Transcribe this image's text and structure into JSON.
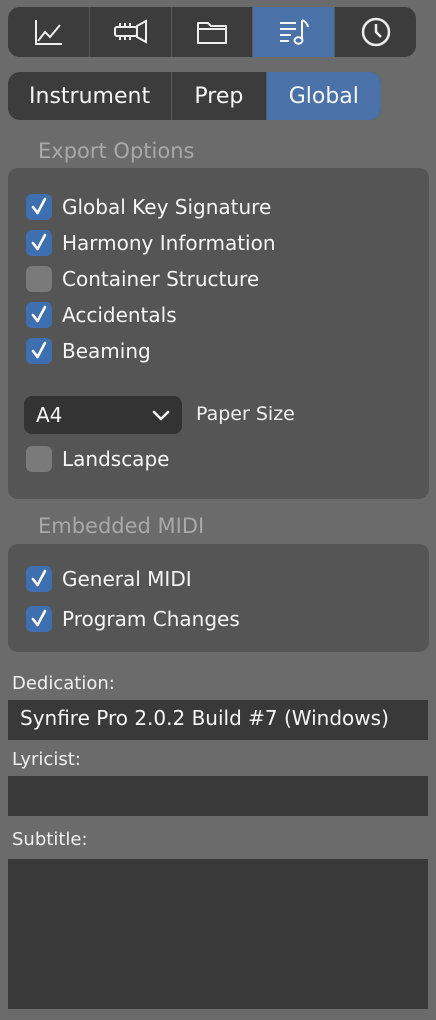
{
  "toolbar": {
    "buttons": [
      {
        "icon": "line-chart-icon",
        "active": false
      },
      {
        "icon": "trumpet-icon",
        "active": false
      },
      {
        "icon": "folder-icon",
        "active": false
      },
      {
        "icon": "score-notes-icon",
        "active": true
      },
      {
        "icon": "clock-icon",
        "active": false
      }
    ]
  },
  "tabs": [
    {
      "label": "Instrument"
    },
    {
      "label": "Prep"
    },
    {
      "label": "Global",
      "active": true
    }
  ],
  "export_options": {
    "title": "Export Options",
    "checks": [
      {
        "label": "Global Key Signature",
        "checked": true
      },
      {
        "label": "Harmony Information",
        "checked": true
      },
      {
        "label": "Container Structure",
        "checked": false
      },
      {
        "label": "Accidentals",
        "checked": true
      },
      {
        "label": "Beaming",
        "checked": true
      }
    ],
    "paper_size_value": "A4",
    "paper_size_label": "Paper Size",
    "landscape": {
      "label": "Landscape",
      "checked": false
    }
  },
  "embedded_midi": {
    "title": "Embedded MIDI",
    "checks": [
      {
        "label": "General MIDI",
        "checked": true
      },
      {
        "label": "Program Changes",
        "checked": true
      }
    ]
  },
  "fields": {
    "dedication": {
      "label": "Dedication:",
      "value": "Synfire Pro 2.0.2 Build #7 (Windows)"
    },
    "lyricist": {
      "label": "Lyricist:",
      "value": ""
    },
    "subtitle": {
      "label": "Subtitle:",
      "value": ""
    }
  },
  "colors": {
    "accent": "#4a72a8",
    "checkbox_on": "#3e6fb0",
    "background": "#6b6b6b"
  }
}
